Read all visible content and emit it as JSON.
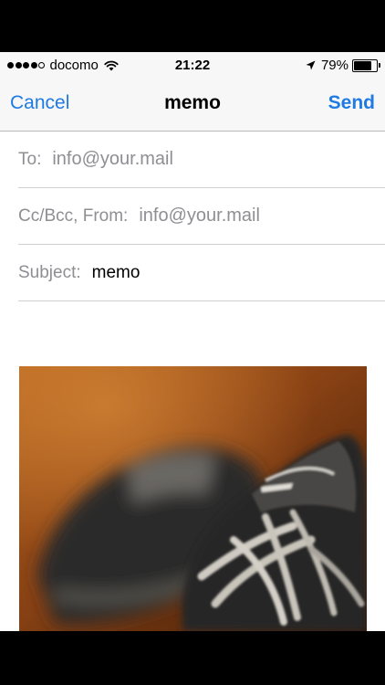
{
  "status_bar": {
    "carrier": "docomo",
    "time": "21:22",
    "battery_percent": "79%",
    "battery_level": 0.79,
    "signal_bars": 4,
    "signal_total": 5
  },
  "nav": {
    "cancel_label": "Cancel",
    "title": "memo",
    "send_label": "Send"
  },
  "fields": {
    "to_label": "To:",
    "to_value": "info@your.mail",
    "ccbcc_label": "Cc/Bcc, From:",
    "ccbcc_value": "info@your.mail",
    "subject_label": "Subject:",
    "subject_value": "memo"
  },
  "body": {
    "attachment_icon": "shoe-photo"
  },
  "colors": {
    "accent": "#1f7ae3",
    "bar_background": "#f7f7f7",
    "label_gray": "#8e8e93"
  }
}
